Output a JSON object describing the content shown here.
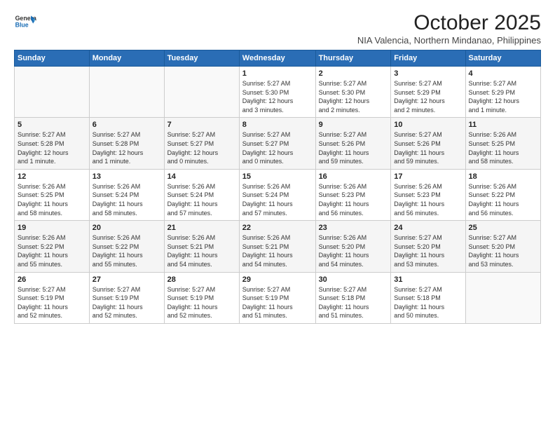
{
  "header": {
    "logo_line1": "General",
    "logo_line2": "Blue",
    "month": "October 2025",
    "location": "NIA Valencia, Northern Mindanao, Philippines"
  },
  "days_of_week": [
    "Sunday",
    "Monday",
    "Tuesday",
    "Wednesday",
    "Thursday",
    "Friday",
    "Saturday"
  ],
  "weeks": [
    [
      {
        "day": "",
        "info": ""
      },
      {
        "day": "",
        "info": ""
      },
      {
        "day": "",
        "info": ""
      },
      {
        "day": "1",
        "info": "Sunrise: 5:27 AM\nSunset: 5:30 PM\nDaylight: 12 hours\nand 3 minutes."
      },
      {
        "day": "2",
        "info": "Sunrise: 5:27 AM\nSunset: 5:30 PM\nDaylight: 12 hours\nand 2 minutes."
      },
      {
        "day": "3",
        "info": "Sunrise: 5:27 AM\nSunset: 5:29 PM\nDaylight: 12 hours\nand 2 minutes."
      },
      {
        "day": "4",
        "info": "Sunrise: 5:27 AM\nSunset: 5:29 PM\nDaylight: 12 hours\nand 1 minute."
      }
    ],
    [
      {
        "day": "5",
        "info": "Sunrise: 5:27 AM\nSunset: 5:28 PM\nDaylight: 12 hours\nand 1 minute."
      },
      {
        "day": "6",
        "info": "Sunrise: 5:27 AM\nSunset: 5:28 PM\nDaylight: 12 hours\nand 1 minute."
      },
      {
        "day": "7",
        "info": "Sunrise: 5:27 AM\nSunset: 5:27 PM\nDaylight: 12 hours\nand 0 minutes."
      },
      {
        "day": "8",
        "info": "Sunrise: 5:27 AM\nSunset: 5:27 PM\nDaylight: 12 hours\nand 0 minutes."
      },
      {
        "day": "9",
        "info": "Sunrise: 5:27 AM\nSunset: 5:26 PM\nDaylight: 11 hours\nand 59 minutes."
      },
      {
        "day": "10",
        "info": "Sunrise: 5:27 AM\nSunset: 5:26 PM\nDaylight: 11 hours\nand 59 minutes."
      },
      {
        "day": "11",
        "info": "Sunrise: 5:26 AM\nSunset: 5:25 PM\nDaylight: 11 hours\nand 58 minutes."
      }
    ],
    [
      {
        "day": "12",
        "info": "Sunrise: 5:26 AM\nSunset: 5:25 PM\nDaylight: 11 hours\nand 58 minutes."
      },
      {
        "day": "13",
        "info": "Sunrise: 5:26 AM\nSunset: 5:24 PM\nDaylight: 11 hours\nand 58 minutes."
      },
      {
        "day": "14",
        "info": "Sunrise: 5:26 AM\nSunset: 5:24 PM\nDaylight: 11 hours\nand 57 minutes."
      },
      {
        "day": "15",
        "info": "Sunrise: 5:26 AM\nSunset: 5:24 PM\nDaylight: 11 hours\nand 57 minutes."
      },
      {
        "day": "16",
        "info": "Sunrise: 5:26 AM\nSunset: 5:23 PM\nDaylight: 11 hours\nand 56 minutes."
      },
      {
        "day": "17",
        "info": "Sunrise: 5:26 AM\nSunset: 5:23 PM\nDaylight: 11 hours\nand 56 minutes."
      },
      {
        "day": "18",
        "info": "Sunrise: 5:26 AM\nSunset: 5:22 PM\nDaylight: 11 hours\nand 56 minutes."
      }
    ],
    [
      {
        "day": "19",
        "info": "Sunrise: 5:26 AM\nSunset: 5:22 PM\nDaylight: 11 hours\nand 55 minutes."
      },
      {
        "day": "20",
        "info": "Sunrise: 5:26 AM\nSunset: 5:22 PM\nDaylight: 11 hours\nand 55 minutes."
      },
      {
        "day": "21",
        "info": "Sunrise: 5:26 AM\nSunset: 5:21 PM\nDaylight: 11 hours\nand 54 minutes."
      },
      {
        "day": "22",
        "info": "Sunrise: 5:26 AM\nSunset: 5:21 PM\nDaylight: 11 hours\nand 54 minutes."
      },
      {
        "day": "23",
        "info": "Sunrise: 5:26 AM\nSunset: 5:20 PM\nDaylight: 11 hours\nand 54 minutes."
      },
      {
        "day": "24",
        "info": "Sunrise: 5:27 AM\nSunset: 5:20 PM\nDaylight: 11 hours\nand 53 minutes."
      },
      {
        "day": "25",
        "info": "Sunrise: 5:27 AM\nSunset: 5:20 PM\nDaylight: 11 hours\nand 53 minutes."
      }
    ],
    [
      {
        "day": "26",
        "info": "Sunrise: 5:27 AM\nSunset: 5:19 PM\nDaylight: 11 hours\nand 52 minutes."
      },
      {
        "day": "27",
        "info": "Sunrise: 5:27 AM\nSunset: 5:19 PM\nDaylight: 11 hours\nand 52 minutes."
      },
      {
        "day": "28",
        "info": "Sunrise: 5:27 AM\nSunset: 5:19 PM\nDaylight: 11 hours\nand 52 minutes."
      },
      {
        "day": "29",
        "info": "Sunrise: 5:27 AM\nSunset: 5:19 PM\nDaylight: 11 hours\nand 51 minutes."
      },
      {
        "day": "30",
        "info": "Sunrise: 5:27 AM\nSunset: 5:18 PM\nDaylight: 11 hours\nand 51 minutes."
      },
      {
        "day": "31",
        "info": "Sunrise: 5:27 AM\nSunset: 5:18 PM\nDaylight: 11 hours\nand 50 minutes."
      },
      {
        "day": "",
        "info": ""
      }
    ]
  ]
}
